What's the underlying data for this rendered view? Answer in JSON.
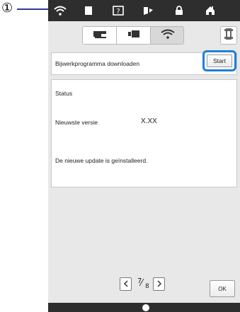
{
  "callout": {
    "label": "①"
  },
  "status_bar": {
    "icons": [
      "wifi-icon",
      "document-icon",
      "help-icon",
      "sewing-icon",
      "lock-icon",
      "home-icon"
    ]
  },
  "tabs": {
    "items": [
      "machine-icon",
      "embroidery-unit-icon",
      "wifi-icon"
    ],
    "selected": "wifi-icon",
    "right_button": "embroidery-frame-icon"
  },
  "download_row": {
    "label": "Bijwerkprogramma downloaden",
    "start_label": "Start"
  },
  "status": {
    "title": "Status",
    "version_label": "Nieuwste versie",
    "version_value": "X.XX",
    "message": "De nieuwe update is geïnstalleerd."
  },
  "pagination": {
    "current": "7",
    "total": "8"
  },
  "ok_label": "OK",
  "colors": {
    "highlight": "#1f7fd6",
    "bar": "#2e2e2e",
    "background": "#e8e8e8"
  }
}
